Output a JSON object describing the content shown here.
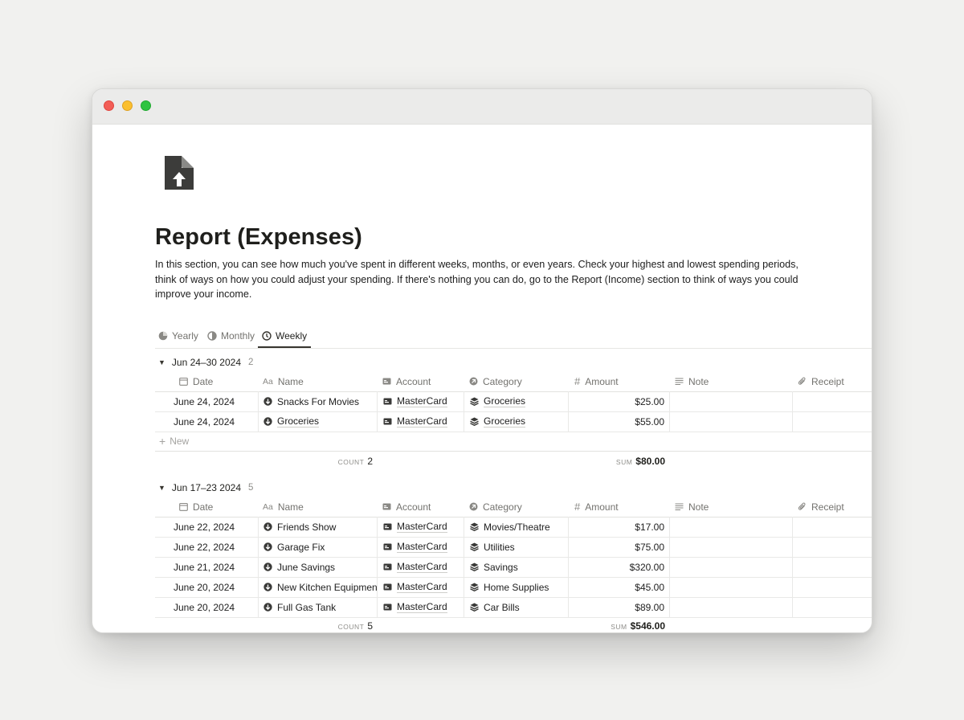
{
  "page": {
    "title": "Report (Expenses)",
    "icon": "upload-document-icon",
    "description": "In this section, you can see how much you've spent in different weeks, months, or even years. Check your highest and lowest spending periods, think of ways on how you could adjust your spending. If there's nothing you can do, go to the Report (Income) section to think of ways you could improve your income."
  },
  "tabs": [
    {
      "label": "Yearly",
      "icon": "pie-chart-icon",
      "active": false
    },
    {
      "label": "Monthly",
      "icon": "pie-chart-icon",
      "active": false
    },
    {
      "label": "Weekly",
      "icon": "clock-icon",
      "active": true
    }
  ],
  "columns": {
    "date": "Date",
    "name": "Name",
    "account": "Account",
    "category": "Category",
    "amount": "Amount",
    "note": "Note",
    "receipt": "Receipt",
    "name_prefix": "Aa"
  },
  "new_label": "New",
  "groups": [
    {
      "title": "Jun 24–30 2024",
      "count": "2",
      "rows": [
        {
          "date": "June 24, 2024",
          "name": "Snacks For Movies",
          "account": "MasterCard",
          "category": "Groceries",
          "amount": "$25.00",
          "note": "",
          "receipt": ""
        },
        {
          "date": "June 24, 2024",
          "name": "Groceries",
          "account": "MasterCard",
          "category": "Groceries",
          "amount": "$55.00",
          "note": "",
          "receipt": ""
        }
      ],
      "count_label": "COUNT",
      "count_value": "2",
      "sum_label": "SUM",
      "sum_value": "$80.00"
    },
    {
      "title": "Jun 17–23 2024",
      "count": "5",
      "rows": [
        {
          "date": "June 22, 2024",
          "name": "Friends Show",
          "account": "MasterCard",
          "category": "Movies/Theatre",
          "amount": "$17.00",
          "note": "",
          "receipt": ""
        },
        {
          "date": "June 22, 2024",
          "name": "Garage Fix",
          "account": "MasterCard",
          "category": "Utilities",
          "amount": "$75.00",
          "note": "",
          "receipt": ""
        },
        {
          "date": "June 21, 2024",
          "name": "June Savings",
          "account": "MasterCard",
          "category": "Savings",
          "amount": "$320.00",
          "note": "",
          "receipt": ""
        },
        {
          "date": "June 20, 2024",
          "name": "New Kitchen Equipment",
          "account": "MasterCard",
          "category": "Home Supplies",
          "amount": "$45.00",
          "note": "",
          "receipt": ""
        },
        {
          "date": "June 20, 2024",
          "name": "Full Gas Tank",
          "account": "MasterCard",
          "category": "Car Bills",
          "amount": "$89.00",
          "note": "",
          "receipt": ""
        }
      ],
      "count_label": "COUNT",
      "count_value": "5",
      "sum_label": "SUM",
      "sum_value": "$546.00"
    }
  ]
}
